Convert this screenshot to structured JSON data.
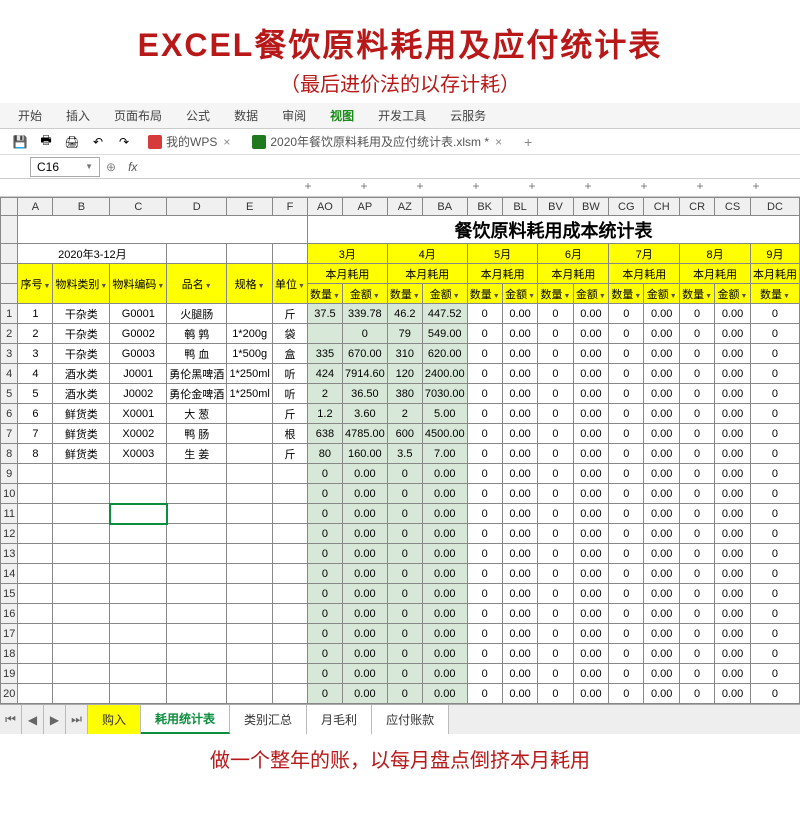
{
  "pageTitle": "EXCEL餐饮原料耗用及应付统计表",
  "pageSubtitle": "（最后进价法的以存计耗）",
  "ribbon": [
    "开始",
    "插入",
    "页面布局",
    "公式",
    "数据",
    "审阅",
    "视图",
    "开发工具",
    "云服务"
  ],
  "ribbonActive": "视图",
  "fileTabs": {
    "wps": "我的WPS",
    "doc": "2020年餐饮原料耗用及应付统计表.xlsm *"
  },
  "nameBox": "C16",
  "colHeaders": [
    "A",
    "B",
    "C",
    "D",
    "E",
    "F",
    "AO",
    "AP",
    "AZ",
    "BA",
    "BK",
    "BL",
    "BV",
    "BW",
    "CG",
    "CH",
    "CR",
    "CS",
    "DC"
  ],
  "bigTitle": "餐饮原料耗用成本统计表",
  "dateSpan": "2020年3-12月",
  "months": [
    "3月",
    "4月",
    "5月",
    "6月",
    "7月",
    "8月",
    "9月"
  ],
  "subHdr": "本月耗用",
  "cols": {
    "seq": "序号",
    "cat": "物料类别",
    "code": "物料编码",
    "name": "品名",
    "spec": "规格",
    "unit": "单位",
    "qty": "数量",
    "amt": "金额"
  },
  "rows": [
    {
      "n": "1",
      "cat": "干杂类",
      "code": "G0001",
      "name": "火腿肠",
      "spec": "",
      "unit": "斤",
      "m3q": "37.5",
      "m3a": "339.78",
      "m4q": "46.2",
      "m4a": "447.52",
      "m5q": "0",
      "m5a": "0.00",
      "m6q": "0",
      "m6a": "0.00",
      "m7q": "0",
      "m7a": "0.00",
      "m8q": "0",
      "m8a": "0.00",
      "m9q": "0"
    },
    {
      "n": "2",
      "cat": "干杂类",
      "code": "G0002",
      "name": "鹌 鹑",
      "spec": "1*200g",
      "unit": "袋",
      "m3q": "",
      "m3a": "0",
      "m4q": "79",
      "m4a": "549.00",
      "m5q": "0",
      "m5a": "0.00",
      "m6q": "0",
      "m6a": "0.00",
      "m7q": "0",
      "m7a": "0.00",
      "m8q": "0",
      "m8a": "0.00",
      "m9q": "0"
    },
    {
      "n": "3",
      "cat": "干杂类",
      "code": "G0003",
      "name": "鸭 血",
      "spec": "1*500g",
      "unit": "盒",
      "m3q": "335",
      "m3a": "670.00",
      "m4q": "310",
      "m4a": "620.00",
      "m5q": "0",
      "m5a": "0.00",
      "m6q": "0",
      "m6a": "0.00",
      "m7q": "0",
      "m7a": "0.00",
      "m8q": "0",
      "m8a": "0.00",
      "m9q": "0"
    },
    {
      "n": "4",
      "cat": "酒水类",
      "code": "J0001",
      "name": "勇伦黑啤酒",
      "spec": "1*250ml",
      "unit": "听",
      "m3q": "424",
      "m3a": "7914.60",
      "m4q": "120",
      "m4a": "2400.00",
      "m5q": "0",
      "m5a": "0.00",
      "m6q": "0",
      "m6a": "0.00",
      "m7q": "0",
      "m7a": "0.00",
      "m8q": "0",
      "m8a": "0.00",
      "m9q": "0"
    },
    {
      "n": "5",
      "cat": "酒水类",
      "code": "J0002",
      "name": "勇伦金啤酒",
      "spec": "1*250ml",
      "unit": "听",
      "m3q": "2",
      "m3a": "36.50",
      "m4q": "380",
      "m4a": "7030.00",
      "m5q": "0",
      "m5a": "0.00",
      "m6q": "0",
      "m6a": "0.00",
      "m7q": "0",
      "m7a": "0.00",
      "m8q": "0",
      "m8a": "0.00",
      "m9q": "0"
    },
    {
      "n": "6",
      "cat": "鲜货类",
      "code": "X0001",
      "name": "大 葱",
      "spec": "",
      "unit": "斤",
      "m3q": "1.2",
      "m3a": "3.60",
      "m4q": "2",
      "m4a": "5.00",
      "m5q": "0",
      "m5a": "0.00",
      "m6q": "0",
      "m6a": "0.00",
      "m7q": "0",
      "m7a": "0.00",
      "m8q": "0",
      "m8a": "0.00",
      "m9q": "0"
    },
    {
      "n": "7",
      "cat": "鲜货类",
      "code": "X0002",
      "name": "鸭 肠",
      "spec": "",
      "unit": "根",
      "m3q": "638",
      "m3a": "4785.00",
      "m4q": "600",
      "m4a": "4500.00",
      "m5q": "0",
      "m5a": "0.00",
      "m6q": "0",
      "m6a": "0.00",
      "m7q": "0",
      "m7a": "0.00",
      "m8q": "0",
      "m8a": "0.00",
      "m9q": "0"
    },
    {
      "n": "8",
      "cat": "鲜货类",
      "code": "X0003",
      "name": "生 姜",
      "spec": "",
      "unit": "斤",
      "m3q": "80",
      "m3a": "160.00",
      "m4q": "3.5",
      "m4a": "7.00",
      "m5q": "0",
      "m5a": "0.00",
      "m6q": "0",
      "m6a": "0.00",
      "m7q": "0",
      "m7a": "0.00",
      "m8q": "0",
      "m8a": "0.00",
      "m9q": "0"
    }
  ],
  "emptyRows": [
    "9",
    "10",
    "11",
    "12",
    "13",
    "14",
    "15",
    "16",
    "17",
    "18",
    "19",
    "20"
  ],
  "zeroQty": "0",
  "zeroAmt": "0.00",
  "sheetTabs": [
    "购入",
    "耗用统计表",
    "类别汇总",
    "月毛利",
    "应付账款"
  ],
  "footer": "做一个整年的账，以每月盘点倒挤本月耗用"
}
